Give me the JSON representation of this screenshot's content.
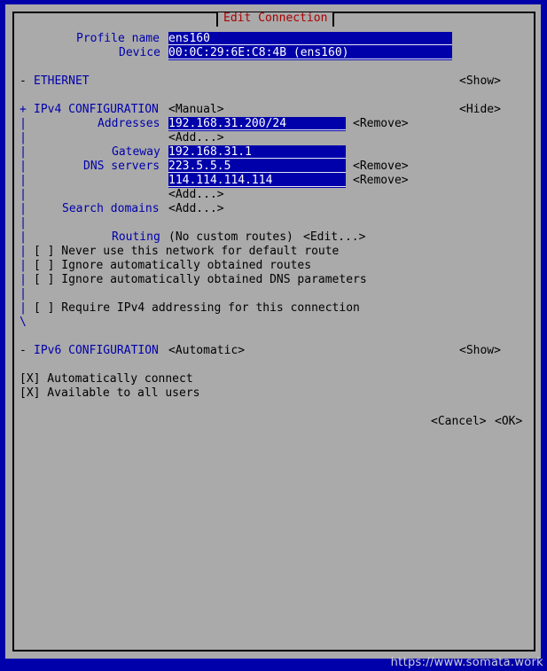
{
  "title": "Edit Connection",
  "profile": {
    "profile_label": "Profile name",
    "profile_value": "ens160",
    "device_label": "Device",
    "device_value": "00:0C:29:6E:C8:4B (ens160)"
  },
  "ethernet": {
    "toggle": "-",
    "label": "ETHERNET",
    "action": "<Show>"
  },
  "ipv4": {
    "toggle": "+",
    "label": "IPv4 CONFIGURATION",
    "mode": "<Manual>",
    "action": "<Hide>",
    "addresses_label": "Addresses",
    "addresses": [
      "192.168.31.200/24"
    ],
    "remove": "<Remove>",
    "add": "<Add...>",
    "gateway_label": "Gateway",
    "gateway": "192.168.31.1",
    "dns_label": "DNS servers",
    "dns": [
      "223.5.5.5",
      "114.114.114.114"
    ],
    "search_label": "Search domains",
    "routing_label": "Routing",
    "routing_value": "(No custom routes)",
    "routing_edit": "<Edit...>",
    "checks": [
      "[ ] Never use this network for default route",
      "[ ] Ignore automatically obtained routes",
      "[ ] Ignore automatically obtained DNS parameters"
    ],
    "require": "[ ] Require IPv4 addressing for this connection",
    "bar": "|",
    "end": "\\"
  },
  "ipv6": {
    "toggle": "-",
    "label": "IPv6 CONFIGURATION",
    "mode": "<Automatic>",
    "action": "<Show>"
  },
  "options": [
    "[X] Automatically connect",
    "[X] Available to all users"
  ],
  "buttons": {
    "cancel": "<Cancel>",
    "ok": "<OK>"
  },
  "watermark": "https://www.somata.work"
}
